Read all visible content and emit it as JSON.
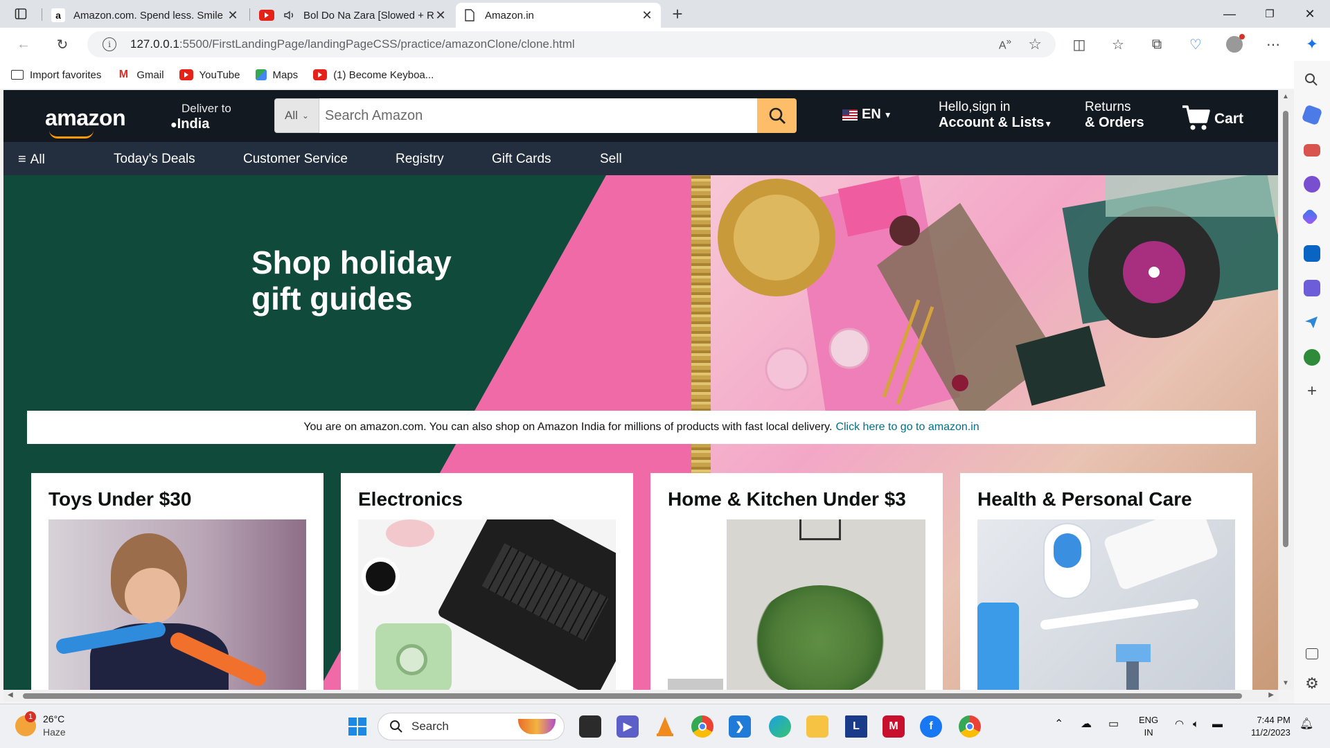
{
  "browser": {
    "tabs": [
      {
        "title": "Amazon.com. Spend less. Smile m",
        "favicon": "amazon-a-icon",
        "active": false
      },
      {
        "title": "Bol Do Na Zara [Slowed + R",
        "favicon": "youtube-icon",
        "active": false,
        "audio": true
      },
      {
        "title": "Amazon.in",
        "favicon": "page-icon",
        "active": true
      }
    ],
    "new_tab_label": "+",
    "address": {
      "host": "127.0.0.1",
      "path": ":5500/FirstLandingPage/landingPageCSS/practice/amazonClone/clone.html"
    },
    "bookmarks": [
      {
        "label": "Import favorites",
        "icon": "import-icon"
      },
      {
        "label": "Gmail",
        "icon": "gmail-icon"
      },
      {
        "label": "YouTube",
        "icon": "youtube-icon"
      },
      {
        "label": "Maps",
        "icon": "maps-icon"
      },
      {
        "label": "(1) Become Keyboa...",
        "icon": "youtube-icon"
      }
    ]
  },
  "header": {
    "logo": "amazon",
    "deliver": {
      "line1": "Deliver to",
      "line2": "India"
    },
    "search": {
      "category": "All",
      "placeholder": "Search Amazon"
    },
    "language": "EN",
    "account": {
      "line1": "Hello,sign in",
      "line2": "Account & Lists"
    },
    "returns": {
      "line1": "Returns",
      "line2": "& Orders"
    },
    "cart": "Cart"
  },
  "nav": {
    "all": "All",
    "links": [
      "Today's Deals",
      "Customer Service",
      "Registry",
      "Gift Cards",
      "Sell"
    ]
  },
  "hero": {
    "heading": "Shop holiday\ngift guides",
    "notice_text": "You are on amazon.com. You can also shop on Amazon India for millions of products with fast local delivery.",
    "notice_link": "Click here to go to amazon.in"
  },
  "cards": [
    {
      "title": "Toys Under $30"
    },
    {
      "title": "Electronics"
    },
    {
      "title": "Home & Kitchen Under $3"
    },
    {
      "title": "Health & Personal Care"
    }
  ],
  "taskbar": {
    "weather": {
      "temp": "26°C",
      "condition": "Haze",
      "badge": "1"
    },
    "search_label": "Search",
    "lang": {
      "line1": "ENG",
      "line2": "IN"
    },
    "clock": {
      "time": "7:44 PM",
      "date": "11/2/2023"
    }
  },
  "colors": {
    "amazon_dark": "#131921",
    "amazon_nav": "#232f3e",
    "amazon_orange": "#ff9900",
    "search_button": "#febd69",
    "hero_green": "#0f4a3a",
    "hero_pink": "#f06aa8",
    "link": "#007185"
  }
}
